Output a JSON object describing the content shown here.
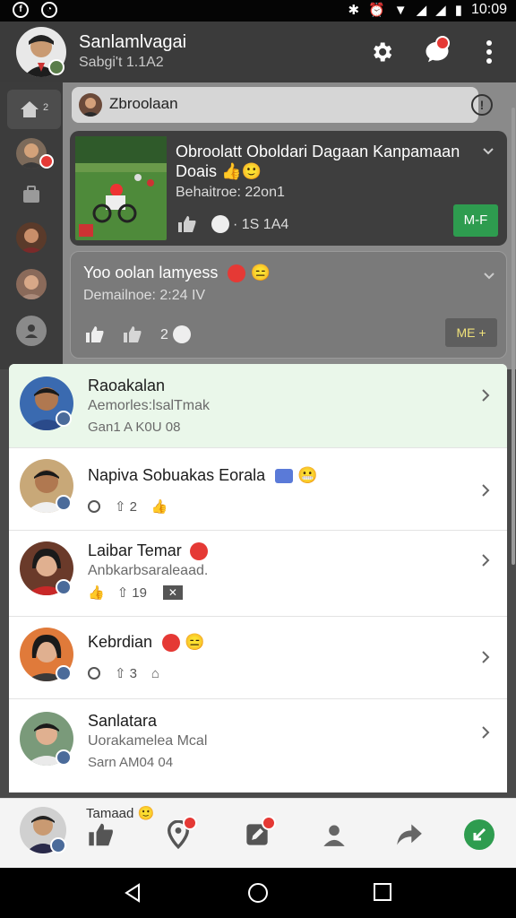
{
  "status_bar": {
    "time": "10:09"
  },
  "header": {
    "title": "Sanlamlvagai",
    "subtitle": "Sabgi't 1.1A2",
    "settings_icon": "gear-icon",
    "chat_icon": "chat-bubble-icon",
    "menu_icon": "more-vert-icon"
  },
  "rail": {
    "home_count": "2"
  },
  "compose": {
    "text": "Zbroolaan",
    "info_icon": "info-icon"
  },
  "posts": [
    {
      "title": "Obroolatt Oboldari Dagaan Kanpamaan Doais",
      "emoji": "👍🙂",
      "meta": "Behaitroe: 22on1",
      "stats": "· 1S 1A4",
      "action": "M-F"
    },
    {
      "title": "Yoo oolan lamyess",
      "emoji": "😑",
      "meta": "Demailnoe: 2:24 IV",
      "stats": "2",
      "action": "ME +"
    }
  ],
  "contacts": [
    {
      "name": "Raoakalan",
      "line2": "Aemorles:lsalTmak",
      "line3": "Gan1 A K0U 08",
      "highlight": true
    },
    {
      "name": "Napiva Sobuakas Eorala",
      "emoji": "😬",
      "stat1": "2",
      "highlight": false
    },
    {
      "name": "Laibar Temar",
      "line2": "Anbkarbsaraleaad.",
      "stat1": "19",
      "highlight": false
    },
    {
      "name": "Kebrdian",
      "emoji": "😑",
      "stat1": "3",
      "highlight": false
    },
    {
      "name": "Sanlatara",
      "line2": "Uorakamelea Mcal",
      "line3": "Sarn AM04 04",
      "highlight": false
    }
  ],
  "peek_text": "Tamaad 🙂",
  "colors": {
    "accent_green": "#2e9c4f",
    "badge_red": "#e53935",
    "header_bg": "#3b3b3b"
  }
}
